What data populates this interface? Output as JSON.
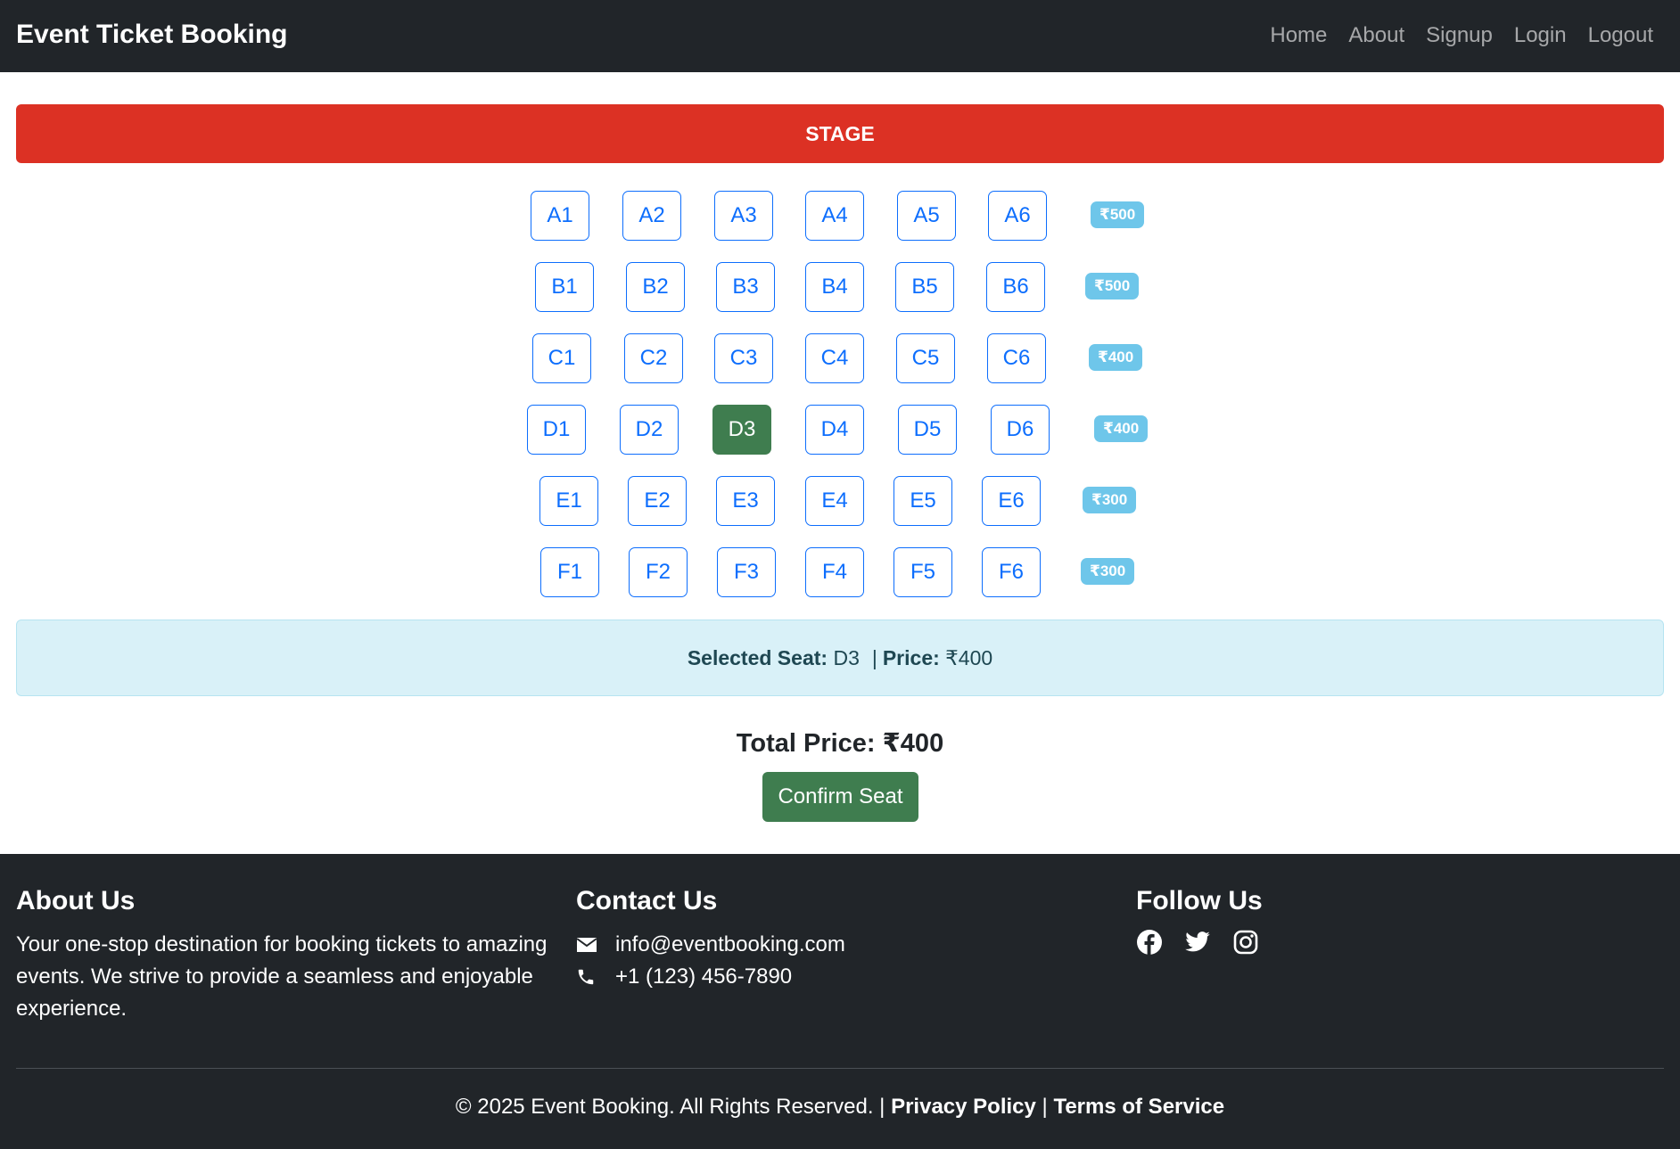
{
  "navbar": {
    "brand": "Event Ticket Booking",
    "links": [
      "Home",
      "About",
      "Signup",
      "Login",
      "Logout"
    ]
  },
  "stage": {
    "label": "STAGE"
  },
  "seating": {
    "rows": [
      {
        "seats": [
          "A1",
          "A2",
          "A3",
          "A4",
          "A5",
          "A6"
        ],
        "price": "₹500"
      },
      {
        "seats": [
          "B1",
          "B2",
          "B3",
          "B4",
          "B5",
          "B6"
        ],
        "price": "₹500"
      },
      {
        "seats": [
          "C1",
          "C2",
          "C3",
          "C4",
          "C5",
          "C6"
        ],
        "price": "₹400"
      },
      {
        "seats": [
          "D1",
          "D2",
          "D3",
          "D4",
          "D5",
          "D6"
        ],
        "price": "₹400"
      },
      {
        "seats": [
          "E1",
          "E2",
          "E3",
          "E4",
          "E5",
          "E6"
        ],
        "price": "₹300"
      },
      {
        "seats": [
          "F1",
          "F2",
          "F3",
          "F4",
          "F5",
          "F6"
        ],
        "price": "₹300"
      }
    ],
    "selected_seat": "D3",
    "selected_color": "#3f7d4f"
  },
  "selection": {
    "seat_label": "Selected Seat:",
    "seat_value": "D3",
    "divider": "|",
    "price_label": "Price:",
    "price_value": "₹400"
  },
  "total": {
    "text": "Total Price: ₹400"
  },
  "confirm_button": {
    "label": "Confirm Seat"
  },
  "footer": {
    "about": {
      "title": "About Us",
      "text": "Your one-stop destination for booking tickets to amazing events. We strive to provide a seamless and enjoyable experience."
    },
    "contact": {
      "title": "Contact Us",
      "email": "info@eventbooking.com",
      "phone": "+1 (123) 456-7890",
      "icons": [
        "envelope-icon",
        "phone-icon"
      ]
    },
    "follow": {
      "title": "Follow Us",
      "icons": [
        "facebook-icon",
        "twitter-icon",
        "instagram-icon"
      ]
    },
    "copyright": "© 2025 Event Booking. All Rights Reserved. |",
    "privacy": "Privacy Policy",
    "link_divider": "|",
    "terms": "Terms of Service"
  },
  "colors": {
    "navbar_bg": "#212529",
    "stage_bg": "#dc3124",
    "seat_border": "#0d6efd",
    "badge_bg": "#6ec6ea",
    "alert_bg": "#d9f1f8",
    "confirm_bg": "#3f7d4f"
  }
}
